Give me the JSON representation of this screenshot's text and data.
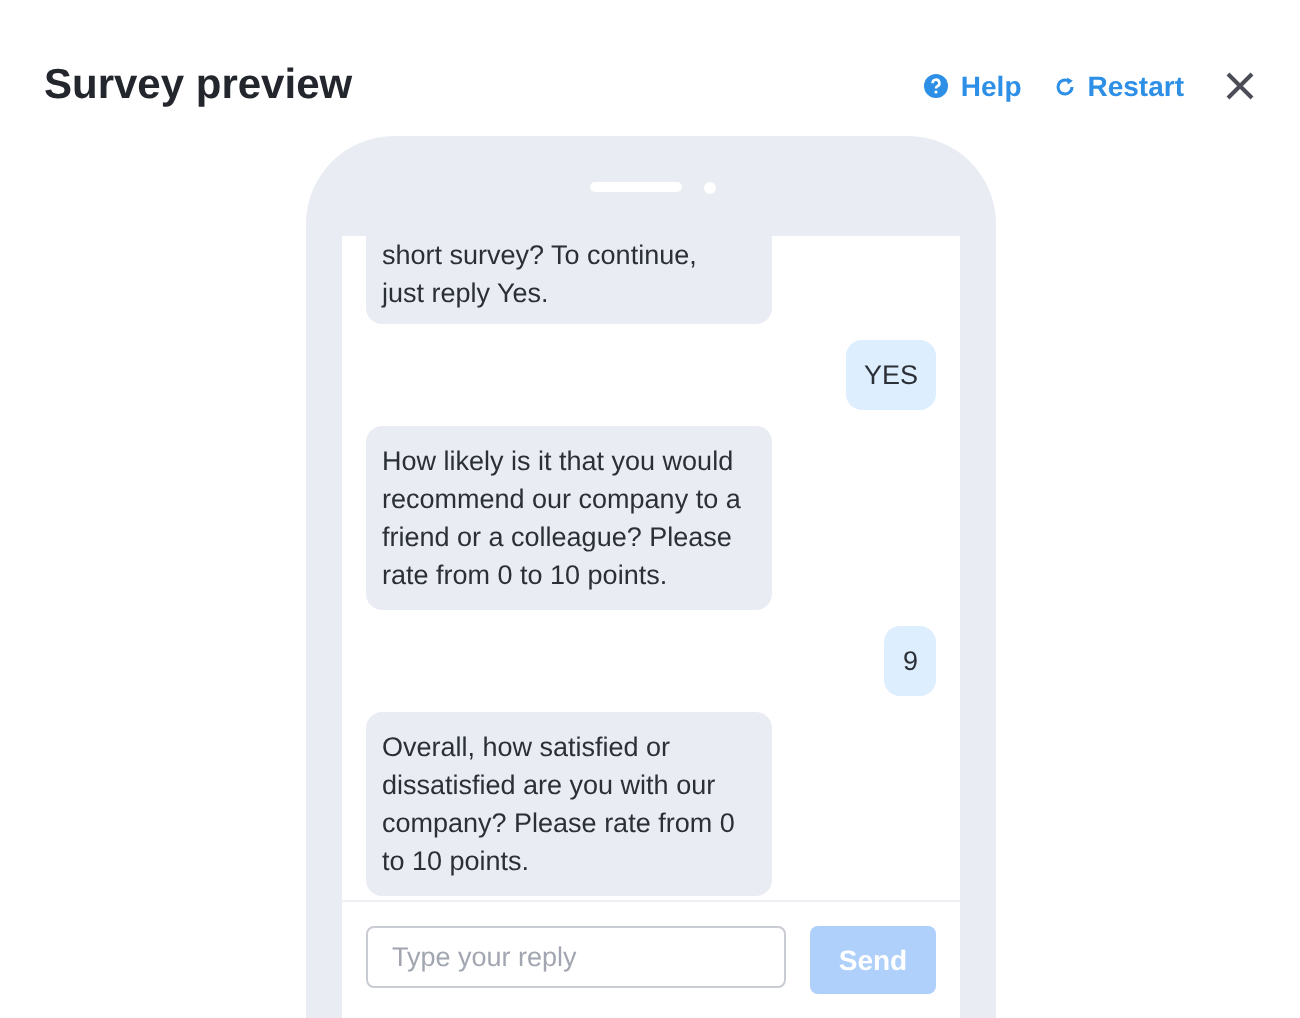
{
  "title": "Survey preview",
  "actions": [
    {
      "kind": "help",
      "label": "Help"
    },
    {
      "kind": "restart",
      "label": "Restart"
    }
  ],
  "messages": [
    {
      "kind": "bot",
      "cut_top": true,
      "text": "short survey? To continue, just reply Yes."
    },
    {
      "kind": "user",
      "text": "YES"
    },
    {
      "kind": "bot",
      "text": "How likely is it that you would recommend our company to a friend or a colleague? Please rate from 0 to 10 points."
    },
    {
      "kind": "user",
      "text": "9"
    },
    {
      "kind": "bot",
      "text": "Overall, how satisfied or dissatisfied are you with our company? Please rate from 0 to 10 points."
    }
  ],
  "reply": {
    "placeholder": "Type your reply"
  },
  "send": {
    "label": "Send",
    "disabled": true
  }
}
